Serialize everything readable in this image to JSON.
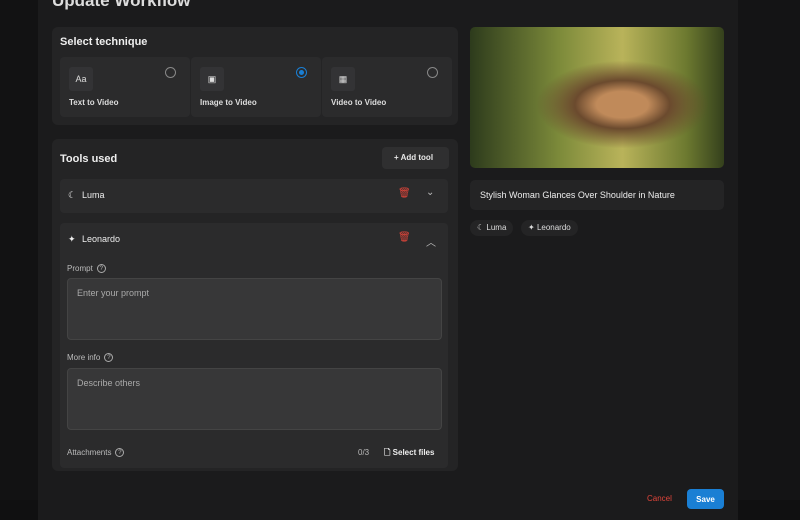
{
  "title": "Update Workflow",
  "technique": {
    "heading": "Select technique",
    "options": [
      {
        "label": "Text to Video",
        "icon": "Aa",
        "selected": false
      },
      {
        "label": "Image to Video",
        "icon": "image-icon",
        "selected": true
      },
      {
        "label": "Video to Video",
        "icon": "film-icon",
        "selected": false
      }
    ]
  },
  "tools": {
    "heading": "Tools used",
    "add_label": "Add tool",
    "items": [
      {
        "name": "Luma"
      },
      {
        "name": "Leonardo"
      }
    ],
    "prompt_label": "Prompt",
    "prompt_placeholder": "Enter your prompt",
    "more_label": "More info",
    "more_placeholder": "Describe others",
    "attach_label": "Attachments",
    "attach_count": "0/3",
    "select_files": "Select files"
  },
  "preview": {
    "caption": "Stylish Woman Glances Over Shoulder in Nature",
    "tags": [
      "Luma",
      "Leonardo"
    ]
  },
  "footer": {
    "cancel": "Cancel",
    "save": "Save"
  },
  "colors": {
    "accent": "#1a7fd4",
    "danger": "#e0453a"
  }
}
